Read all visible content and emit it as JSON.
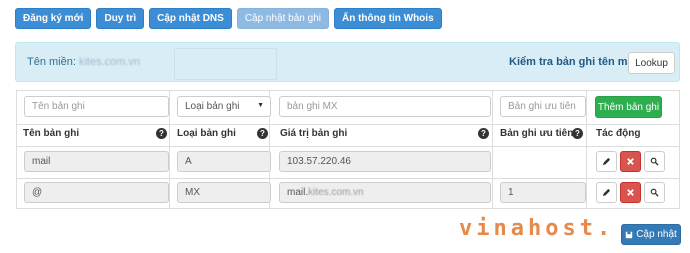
{
  "toolbar": {
    "buttons": [
      {
        "label": "Đăng ký mới"
      },
      {
        "label": "Duy trì"
      },
      {
        "label": "Cập nhật DNS"
      },
      {
        "label": "Cập nhật bản ghi"
      },
      {
        "label": "Ẩn thông tin Whois"
      }
    ]
  },
  "info": {
    "domain_label": "Tên miền:",
    "domain_value": "kites.com.vn",
    "check_label": "Kiểm tra bản ghi tên miền",
    "lookup_label": "Lookup"
  },
  "new_record": {
    "name_placeholder": "Tên bản ghi",
    "type_selected": "Loại bản ghi",
    "value_placeholder": "bản ghi MX",
    "priority_placeholder": "Bản ghi ưu tiên",
    "add_label": "Thêm bản ghi"
  },
  "headers": {
    "name": "Tên bản ghi",
    "type": "Loại bản ghi",
    "value": "Giá trị bản ghi",
    "priority": "Bản ghi ưu tiên",
    "action": "Tác động",
    "help": "?"
  },
  "records": [
    {
      "name": "mail",
      "type": "A",
      "value": "103.57.220.46",
      "priority": ""
    },
    {
      "name": "@",
      "type": "MX",
      "value_prefix": "mail.",
      "value_blur": "kites.com.vn",
      "priority": "1"
    }
  ],
  "footer": {
    "logo_text": "vinahost.",
    "update_label": "Cập nhật"
  },
  "colors": {
    "primary": "#3b8ed6",
    "success": "#2eaf4f",
    "danger": "#d9534f",
    "info_bg": "#d9edf7"
  }
}
